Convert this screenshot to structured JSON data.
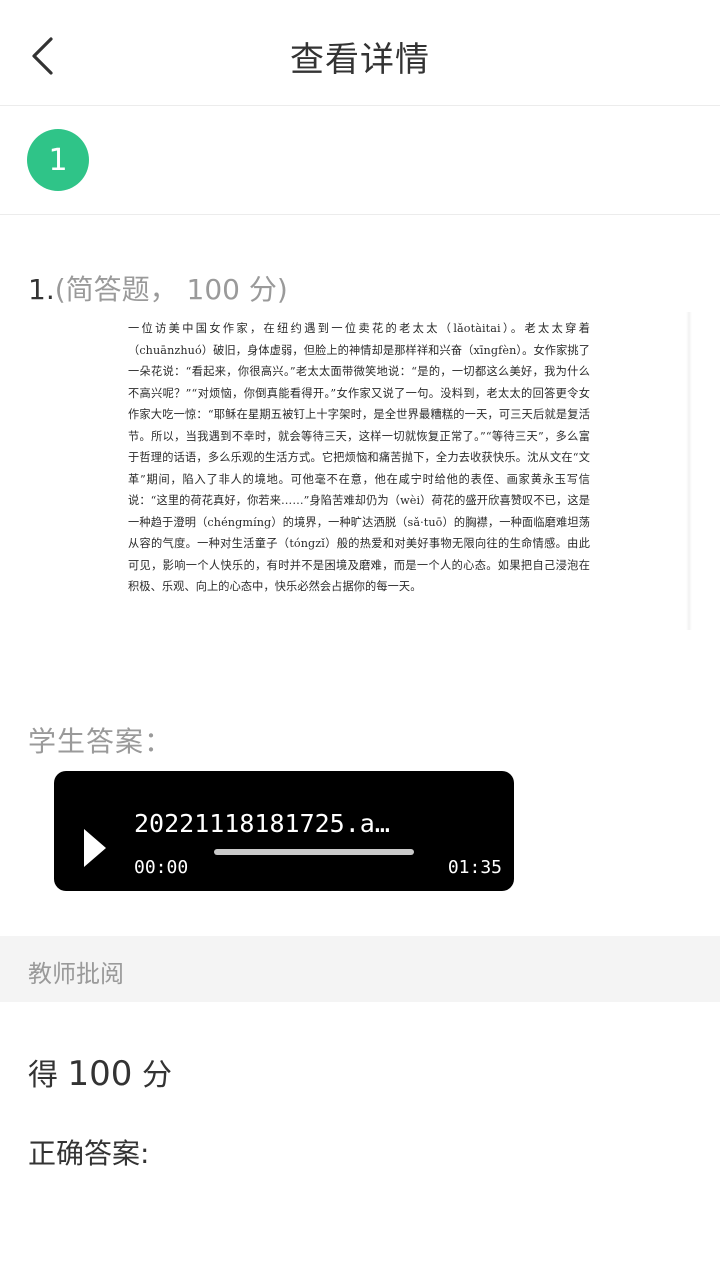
{
  "header": {
    "title": "查看详情",
    "back_icon": "chevron-left-icon"
  },
  "question_index": "1",
  "question": {
    "number": "1.",
    "meta": "(简答题， 100 分)",
    "passage": "一位访美中国女作家，在纽约遇到一位卖花的老太太（lǎotàitai）。老太太穿着（chuānzhuó）破旧，身体虚弱，但脸上的神情却是那样祥和兴奋（xīngfèn）。女作家挑了一朵花说：“看起来，你很高兴。”老太太面带微笑地说：“是的，一切都这么美好，我为什么不高兴呢？”“对烦恼，你倒真能看得开。”女作家又说了一句。没料到，老太太的回答更令女作家大吃一惊：“耶稣在星期五被钉上十字架时，是全世界最糟糕的一天，可三天后就是复活节。所以，当我遇到不幸时，就会等待三天，这样一切就恢复正常了。”“等待三天”，多么富于哲理的话语，多么乐观的生活方式。它把烦恼和痛苦抛下，全力去收获快乐。沈从文在“文革”期间，陷入了非人的境地。可他毫不在意，他在咸宁时给他的表侄、画家黄永玉写信说：“这里的荷花真好，你若来……”身陷苦难却仍为（wèi）荷花的盛开欣喜赞叹不已，这是一种趋于澄明（chéngmíng）的境界，一种旷达洒脱（sǎ·tuō）的胸襟，一种面临磨难坦荡从容的气度。一种对生活童子（tóngzǐ）般的热爱和对美好事物无限向往的生命情感。由此可见，影响一个人快乐的，有时并不是困境及磨难，而是一个人的心态。如果把自己浸泡在积极、乐观、向上的心态中，快乐必然会占据你的每一天。"
  },
  "student_answer": {
    "label": "学生答案：",
    "audio": {
      "filename": "20221118181725.a…",
      "current_time": "00:00",
      "total_time": "01:35",
      "progress": 0,
      "play_icon": "play-icon"
    }
  },
  "teacher_review": {
    "section_title": "教师批阅",
    "score_prefix": "得",
    "score_value": "100",
    "score_suffix": "分",
    "correct_answer_label": "正确答案:"
  },
  "colors": {
    "accent": "#2fc488",
    "player_bg": "#000000",
    "muted_text": "#9a9a9a"
  }
}
